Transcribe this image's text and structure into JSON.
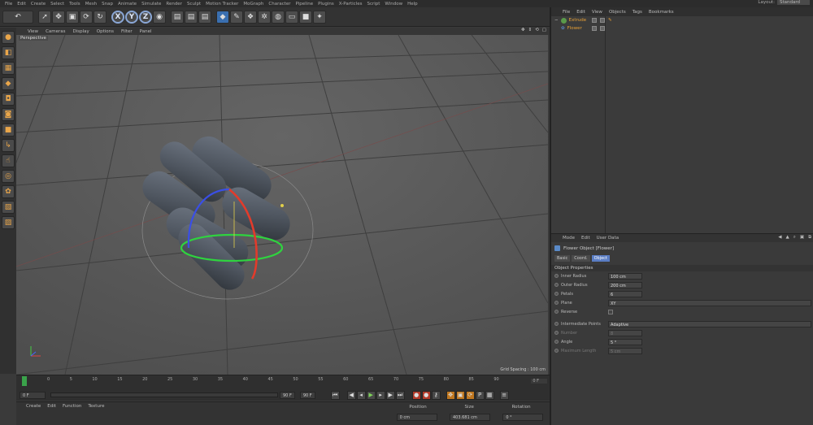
{
  "menubar": {
    "items": [
      "File",
      "Edit",
      "Create",
      "Select",
      "Tools",
      "Mesh",
      "Snap",
      "Animate",
      "Simulate",
      "Render",
      "Sculpt",
      "Motion Tracker",
      "MoGraph",
      "Character",
      "Pipeline",
      "Plugins",
      "X-Particles",
      "Script",
      "Window",
      "Help"
    ],
    "layout_label": "Layout:",
    "layout_value": "Standard"
  },
  "toolbar": {
    "axes": [
      "X",
      "Y",
      "Z"
    ]
  },
  "viewport": {
    "menu": [
      "View",
      "Cameras",
      "Display",
      "Options",
      "Filter",
      "Panel"
    ],
    "label": "Perspective",
    "grid_spacing": "Grid Spacing : 100 cm"
  },
  "timeline": {
    "ticks": [
      "0",
      "5",
      "10",
      "15",
      "20",
      "25",
      "30",
      "35",
      "40",
      "45",
      "50",
      "55",
      "60",
      "65",
      "70",
      "75",
      "80",
      "85",
      "90"
    ],
    "end_frame": "0 F"
  },
  "transport": {
    "start": "0 F",
    "end": "90 F",
    "min": "90 F"
  },
  "material": {
    "menu": [
      "Create",
      "Edit",
      "Function",
      "Texture"
    ]
  },
  "coords": {
    "headers": [
      "Position",
      "Size",
      "Rotation"
    ],
    "position": "0 cm",
    "size": "403.681 cm",
    "rotation": "0 °"
  },
  "object_manager": {
    "menu": [
      "File",
      "Edit",
      "View",
      "Objects",
      "Tags",
      "Bookmarks"
    ],
    "objects": [
      {
        "name": "Extrude"
      },
      {
        "name": "Flower"
      }
    ]
  },
  "attributes": {
    "menu": [
      "Mode",
      "Edit",
      "User Data"
    ],
    "title": "Flower Object [Flower]",
    "tabs": [
      "Basic",
      "Coord.",
      "Object"
    ],
    "section": "Object Properties",
    "props": [
      {
        "label": "Inner Radius",
        "value": "100 cm"
      },
      {
        "label": "Outer Radius",
        "value": "200 cm"
      },
      {
        "label": "Petals",
        "value": "6"
      },
      {
        "label": "Plane",
        "value": "XY"
      },
      {
        "label": "Reverse",
        "value": ""
      },
      {
        "label": "Intermediate Points",
        "value": "Adaptive"
      },
      {
        "label": "Number",
        "value": "8"
      },
      {
        "label": "Angle",
        "value": "5 °"
      },
      {
        "label": "Maximum Length",
        "value": "5 cm"
      }
    ]
  }
}
